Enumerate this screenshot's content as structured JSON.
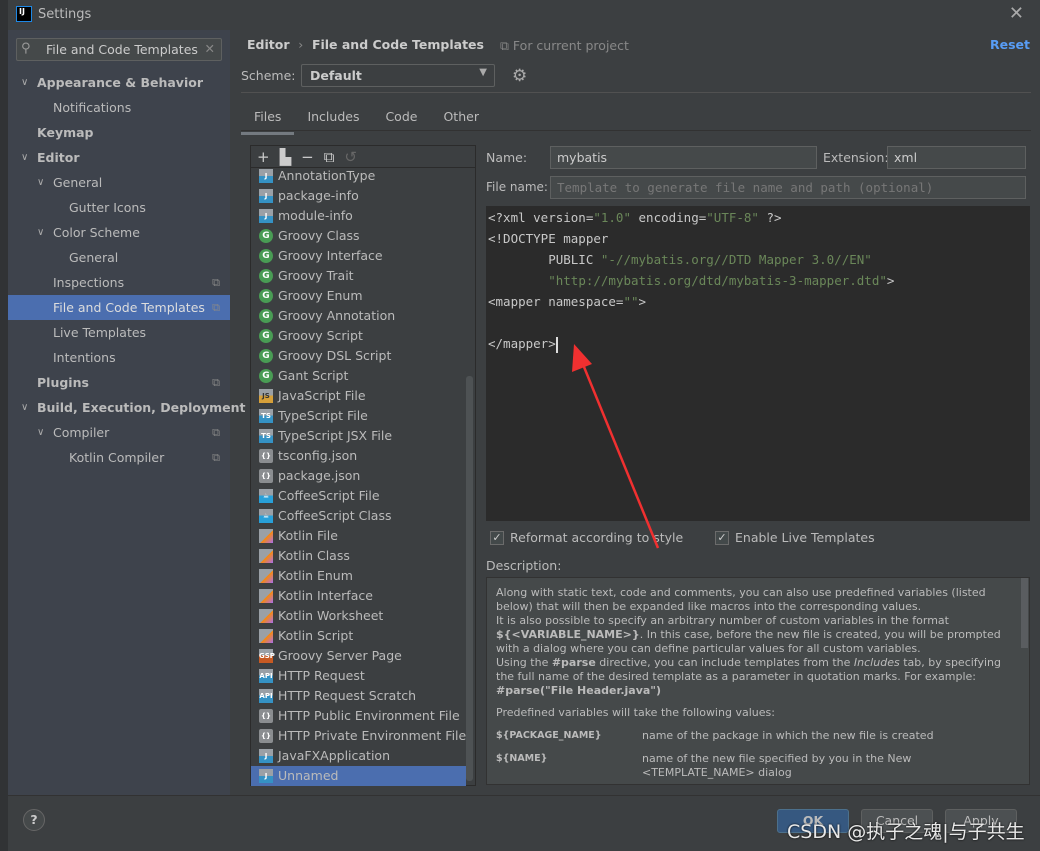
{
  "window": {
    "title": "Settings",
    "app_logo": "IJ"
  },
  "search": {
    "value": "File and Code Templates"
  },
  "sidebar": {
    "items": [
      {
        "label": "Appearance & Behavior",
        "level": 0,
        "bold": true,
        "expanded": true
      },
      {
        "label": "Notifications",
        "level": 2
      },
      {
        "label": "Keymap",
        "level": 0,
        "bold": true
      },
      {
        "label": "Editor",
        "level": 0,
        "bold": true,
        "expanded": true
      },
      {
        "label": "General",
        "level": 1,
        "expanded": true
      },
      {
        "label": "Gutter Icons",
        "level": 3
      },
      {
        "label": "Color Scheme",
        "level": 1,
        "expanded": true
      },
      {
        "label": "General",
        "level": 3
      },
      {
        "label": "Inspections",
        "level": 2,
        "copy": true
      },
      {
        "label": "File and Code Templates",
        "level": 2,
        "selected": true,
        "copy": true
      },
      {
        "label": "Live Templates",
        "level": 2
      },
      {
        "label": "Intentions",
        "level": 2
      },
      {
        "label": "Plugins",
        "level": 0,
        "bold": true,
        "copy": true
      },
      {
        "label": "Build, Execution, Deployment",
        "level": 0,
        "bold": true,
        "expanded": true
      },
      {
        "label": "Compiler",
        "level": 1,
        "expanded": true,
        "copy": true
      },
      {
        "label": "Kotlin Compiler",
        "level": 3,
        "copy": true
      }
    ]
  },
  "header": {
    "breadcrumb": [
      "Editor",
      "File and Code Templates"
    ],
    "project_label": "For current project",
    "reset": "Reset"
  },
  "scheme": {
    "label": "Scheme:",
    "value": "Default"
  },
  "tabs": [
    {
      "label": "Files",
      "active": true
    },
    {
      "label": "Includes"
    },
    {
      "label": "Code"
    },
    {
      "label": "Other"
    }
  ],
  "templates": [
    {
      "label": "AnnotationType",
      "icon": "j"
    },
    {
      "label": "package-info",
      "icon": "j"
    },
    {
      "label": "module-info",
      "icon": "j"
    },
    {
      "label": "Groovy Class",
      "icon": "g"
    },
    {
      "label": "Groovy Interface",
      "icon": "g"
    },
    {
      "label": "Groovy Trait",
      "icon": "g"
    },
    {
      "label": "Groovy Enum",
      "icon": "g"
    },
    {
      "label": "Groovy Annotation",
      "icon": "g"
    },
    {
      "label": "Groovy Script",
      "icon": "g"
    },
    {
      "label": "Groovy DSL Script",
      "icon": "g"
    },
    {
      "label": "Gant Script",
      "icon": "g"
    },
    {
      "label": "JavaScript File",
      "icon": "js"
    },
    {
      "label": "TypeScript File",
      "icon": "ts"
    },
    {
      "label": "TypeScript JSX File",
      "icon": "ts"
    },
    {
      "label": "tsconfig.json",
      "icon": "json"
    },
    {
      "label": "package.json",
      "icon": "json"
    },
    {
      "label": "CoffeeScript File",
      "icon": "cs"
    },
    {
      "label": "CoffeeScript Class",
      "icon": "cs"
    },
    {
      "label": "Kotlin File",
      "icon": "kt"
    },
    {
      "label": "Kotlin Class",
      "icon": "kt"
    },
    {
      "label": "Kotlin Enum",
      "icon": "kt"
    },
    {
      "label": "Kotlin Interface",
      "icon": "kt"
    },
    {
      "label": "Kotlin Worksheet",
      "icon": "kt"
    },
    {
      "label": "Kotlin Script",
      "icon": "kt"
    },
    {
      "label": "Groovy Server Page",
      "icon": "gsp"
    },
    {
      "label": "HTTP Request",
      "icon": "api"
    },
    {
      "label": "HTTP Request Scratch",
      "icon": "api"
    },
    {
      "label": "HTTP Public Environment File",
      "icon": "json"
    },
    {
      "label": "HTTP Private Environment File",
      "icon": "json"
    },
    {
      "label": "JavaFXApplication",
      "icon": "j"
    },
    {
      "label": "Unnamed",
      "icon": "j",
      "selected": true
    }
  ],
  "icon_badges": {
    "j": "J",
    "g": "G",
    "js": "JS",
    "ts": "TS",
    "json": "{}",
    "cs": "☕",
    "kt": "",
    "gsp": "GSP",
    "api": "API"
  },
  "form": {
    "name_label": "Name:",
    "name_value": "mybatis",
    "ext_label": "Extension:",
    "ext_value": "xml",
    "filename_label": "File name:",
    "filename_placeholder": "Template to generate file name and path (optional)"
  },
  "code": [
    [
      [
        "<?xml version=",
        ""
      ],
      [
        "\"1.0\"",
        "s"
      ],
      [
        " encoding=",
        ""
      ],
      [
        "\"UTF-8\"",
        "s"
      ],
      [
        " ?>",
        ""
      ]
    ],
    [
      [
        "<!DOCTYPE mapper",
        ""
      ]
    ],
    [
      [
        "        PUBLIC ",
        ""
      ],
      [
        "\"-//mybatis.org//DTD Mapper 3.0//EN\"",
        "s"
      ]
    ],
    [
      [
        "        ",
        ""
      ],
      [
        "\"http://mybatis.org/dtd/mybatis-3-mapper.dtd\"",
        "s"
      ],
      [
        ">",
        ""
      ]
    ],
    [
      [
        "<mapper namespace=",
        ""
      ],
      [
        "\"\"",
        "s"
      ],
      [
        ">",
        ""
      ]
    ],
    [],
    [
      [
        "</mapper>",
        ""
      ]
    ]
  ],
  "options": {
    "reformat": {
      "label": "Reformat according to style",
      "checked": true
    },
    "live": {
      "label": "Enable Live Templates",
      "checked": true
    }
  },
  "description": {
    "label": "Description:",
    "p1": "Along with static text, code and comments, you can also use predefined variables (listed below) that will then be expanded like macros into the corresponding values.",
    "p2a": "It is also possible to specify an arbitrary number of custom variables in the format ",
    "p2b": "${<VARIABLE_NAME>}",
    "p2c": ". In this case, before the new file is created, you will be prompted with a dialog where you can define particular values for all custom variables.",
    "p3a": "Using the ",
    "p3b": "#parse",
    "p3c": " directive, you can include templates from the ",
    "p3d": "Includes",
    "p3e": " tab, by specifying the full name of the desired template as a parameter in quotation marks. For example:",
    "p3f": "#parse(\"File Header.java\")",
    "p4": "Predefined variables will take the following values:",
    "vars": [
      {
        "name": "${PACKAGE_NAME}",
        "desc": "name of the package in which the new file is created"
      },
      {
        "name": "${NAME}",
        "desc": "name of the new file specified by you in the New <TEMPLATE_NAME> dialog"
      }
    ]
  },
  "buttons": {
    "help": "?",
    "ok": "OK",
    "cancel": "Cancel",
    "apply": "Apply"
  },
  "watermark": "CSDN @执子之魂|与子共生",
  "colors": {
    "selection": "#4b6eaf",
    "link": "#589df6",
    "string": "#6a8759",
    "annotation_arrow": "#f03030"
  }
}
